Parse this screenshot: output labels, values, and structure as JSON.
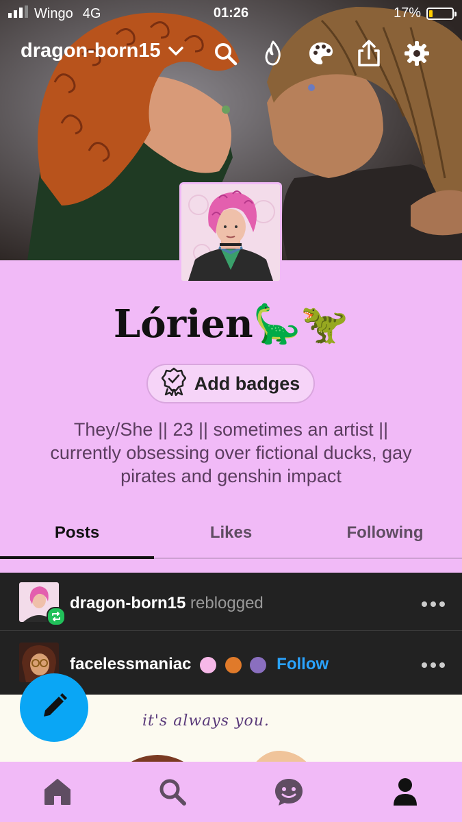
{
  "status_bar": {
    "carrier": "Wingo",
    "network": "4G",
    "time": "01:26",
    "battery_text": "17%",
    "battery_level": 0.17
  },
  "topbar": {
    "blog_name": "dragon-born15"
  },
  "profile": {
    "title": "Lórien🦕🦖",
    "badges_label": "Add badges",
    "bio_lines": [
      "They/She || 23 || sometimes an artist ||",
      "currently obsessing over fictional ducks, gay",
      "pirates and genshin impact"
    ]
  },
  "tabs": [
    {
      "label": "Posts"
    },
    {
      "label": "Likes"
    },
    {
      "label": "Following"
    }
  ],
  "post": {
    "reblogger": "dragon-born15",
    "reblogged_text": "reblogged",
    "author": "facelessmaniac",
    "follow_label": "Follow",
    "image_text": "it's always you."
  },
  "colors": {
    "accent": "#0aa6f5",
    "background": "#f1baf7",
    "follow": "#2aa3ff",
    "post_bg": "#222222"
  }
}
